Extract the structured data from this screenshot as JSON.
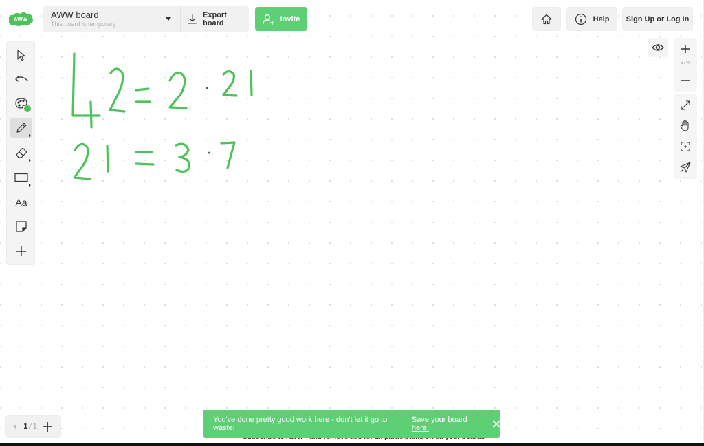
{
  "app": {
    "logo_text": "AWW",
    "brand_color": "#5fcf75"
  },
  "header": {
    "board_title": "AWW board",
    "board_subtitle": "This board is temporary",
    "export_label": "Export board",
    "invite_label": "Invite",
    "help_label": "Help",
    "signup_label": "Sign Up or Log In"
  },
  "left_toolbar": {
    "tools": [
      {
        "name": "select",
        "icon": "cursor-arrow-icon"
      },
      {
        "name": "undo",
        "icon": "undo-icon"
      },
      {
        "name": "color",
        "icon": "palette-icon",
        "current_color": "#4cc35a"
      },
      {
        "name": "pen",
        "icon": "pencil-icon",
        "active": true
      },
      {
        "name": "eraser",
        "icon": "eraser-icon"
      },
      {
        "name": "shape",
        "icon": "rectangle-icon"
      },
      {
        "name": "text",
        "icon": "text-icon",
        "label": "Aa"
      },
      {
        "name": "sticky-note",
        "icon": "sticky-note-icon"
      },
      {
        "name": "more",
        "icon": "plus-icon"
      }
    ]
  },
  "right_toolbar": {
    "zoom_level": "97%",
    "tools": [
      "expand-icon",
      "hand-icon",
      "focus-icon",
      "laser-pointer-icon"
    ]
  },
  "canvas": {
    "ink_color": "#4cc35a",
    "lines": [
      "42 = 2 · 21",
      "21 = 3 · 7"
    ]
  },
  "pages": {
    "current": "1",
    "total": "/1"
  },
  "toast": {
    "message": "You've done pretty good work here - don't let it go to waste!",
    "link": "Save your board here."
  },
  "ad_banner": {
    "text": "Subscribe to AWW+ and remove ads for all participants on all your boards"
  }
}
